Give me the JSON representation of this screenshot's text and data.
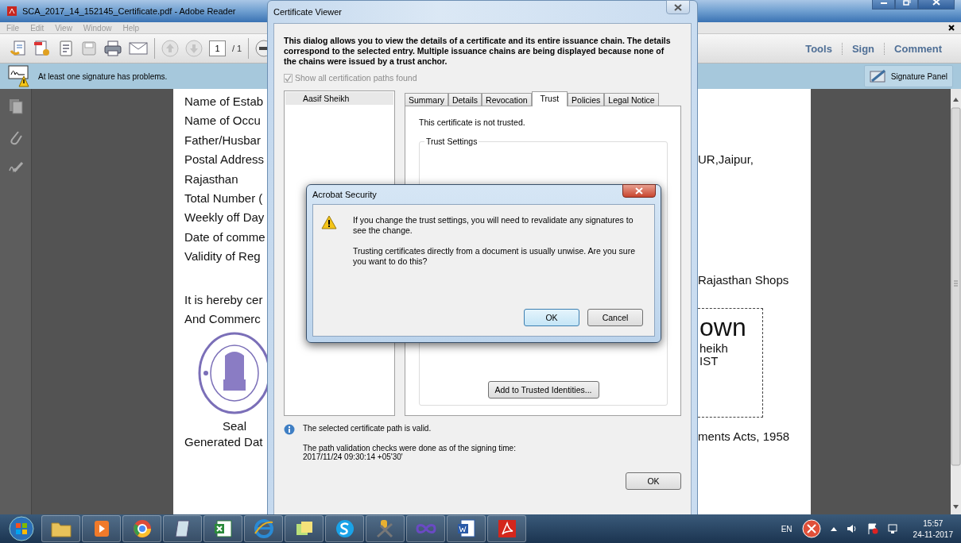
{
  "reader": {
    "title": "SCA_2017_14_152145_Certificate.pdf - Adobe Reader",
    "menu": [
      {
        "label": "File",
        "disabled": true
      },
      {
        "label": "Edit",
        "disabled": true
      },
      {
        "label": "View",
        "disabled": true
      },
      {
        "label": "Window",
        "disabled": true
      },
      {
        "label": "Help",
        "disabled": true
      }
    ],
    "page_number": "1",
    "page_count": "/ 1",
    "panel_links": [
      "Tools",
      "Sign",
      "Comment"
    ],
    "notice": "At least one signature has problems.",
    "signature_panel": "Signature Panel",
    "document": {
      "detail_lines": [
        "Name of Estab",
        "Name of Occu",
        "Father/Husbar",
        "Postal Address",
        "Rajasthan",
        "Total Number (",
        "Weekly off Day",
        "Date of comme",
        "Validity of Reg"
      ],
      "statement_lines": [
        "It is hereby cer",
        "And Commerc"
      ],
      "seal_caption": "Seal",
      "generated_line": "Generated Dat",
      "address_tail": "UR,Jaipur,",
      "act_tail": "Rajasthan Shops",
      "signature": [
        "own",
        "heikh",
        "IST"
      ],
      "acts_tail": "ments Acts, 1958"
    }
  },
  "certificate_viewer": {
    "title": "Certificate Viewer",
    "description": "This dialog allows you to view the details of a certificate and its entire issuance chain. The details correspond to the selected entry. Multiple issuance chains are being displayed because none of the chains were issued by a trust anchor.",
    "checkbox": {
      "label": "Show all certification paths found",
      "checked": true,
      "disabled": true
    },
    "tree": [
      {
        "label": "Aasif Sheikh",
        "selected": true
      }
    ],
    "tabs": [
      {
        "label": "Summary",
        "selected": false
      },
      {
        "label": "Details",
        "selected": false
      },
      {
        "label": "Revocation",
        "selected": false
      },
      {
        "label": "Trust",
        "selected": true
      },
      {
        "label": "Policies",
        "selected": false
      },
      {
        "label": "Legal Notice",
        "selected": false
      }
    ],
    "trust_status": "This certificate is not trusted.",
    "trust_settings_label": "Trust Settings",
    "add_button": "Add to Trusted Identities...",
    "path_status": "The selected certificate path is valid.",
    "validation_note": "The path validation checks were done as of the signing time:",
    "signing_time": "2017/11/24 09:30:14 +05'30'",
    "ok_button": "OK"
  },
  "security_dialog": {
    "title": "Acrobat Security",
    "messages": [
      "If you change the trust settings, you will need to revalidate any signatures to see the change.",
      "Trusting certificates directly from a document is usually unwise. Are you sure you want to do this?"
    ],
    "buttons": [
      {
        "label": "OK",
        "default": true
      },
      {
        "label": "Cancel",
        "default": false
      }
    ]
  },
  "taskbar": {
    "language": "EN",
    "time": "15:57",
    "date": "24-11-2017"
  }
}
